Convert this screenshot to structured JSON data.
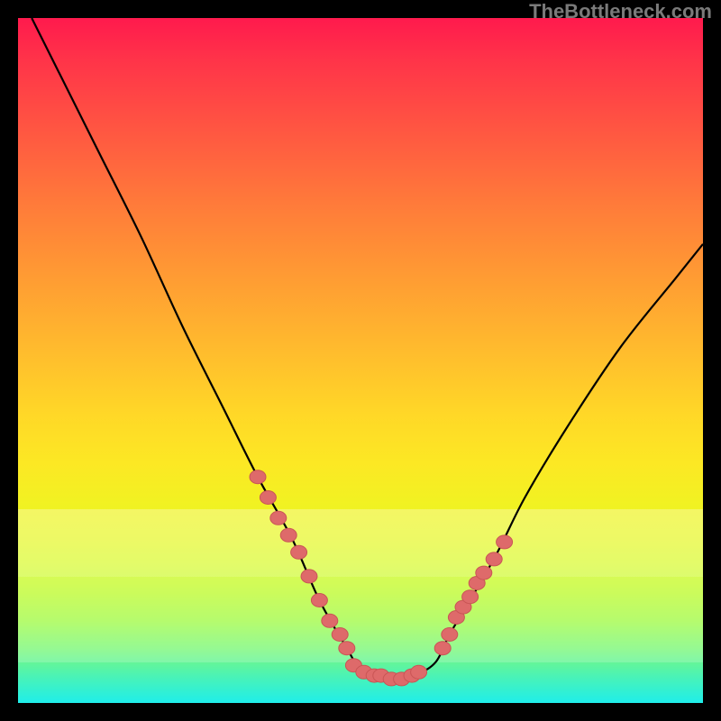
{
  "attribution": "TheBottleneck.com",
  "chart_data": {
    "type": "line",
    "title": "",
    "xlabel": "",
    "ylabel": "",
    "x_range": [
      0,
      100
    ],
    "y_range": [
      0,
      100
    ],
    "curve": {
      "x": [
        2,
        6,
        12,
        18,
        24,
        30,
        35,
        40,
        44,
        48,
        50,
        53,
        55,
        58,
        61,
        63,
        66,
        70,
        74,
        80,
        88,
        96,
        100
      ],
      "y": [
        100,
        92,
        80,
        68,
        55,
        43,
        33,
        24,
        15,
        8,
        5,
        4,
        3,
        4,
        6,
        10,
        15,
        22,
        30,
        40,
        52,
        62,
        67
      ]
    },
    "red_dots_left": {
      "x": [
        35.0,
        36.5,
        38.0,
        39.5,
        41.0,
        42.5,
        44.0,
        45.5,
        47.0,
        48.0
      ],
      "y": [
        33.0,
        30.0,
        27.0,
        24.5,
        22.0,
        18.5,
        15.0,
        12.0,
        10.0,
        8.0
      ]
    },
    "red_dots_bottom": {
      "x": [
        49.0,
        50.5,
        52.0,
        53.0,
        54.5,
        56.0,
        57.5,
        58.5
      ],
      "y": [
        5.5,
        4.5,
        4.0,
        4.0,
        3.5,
        3.5,
        4.0,
        4.5
      ]
    },
    "red_dots_right": {
      "x": [
        62.0,
        63.0,
        64.0,
        65.0,
        66.0,
        67.0,
        68.0,
        69.5,
        71.0
      ],
      "y": [
        8.0,
        10.0,
        12.5,
        14.0,
        15.5,
        17.5,
        19.0,
        21.0,
        23.5
      ]
    },
    "colors": {
      "curve": "#000000",
      "dot_fill": "#de6a6a",
      "dot_stroke": "#c95555"
    }
  }
}
